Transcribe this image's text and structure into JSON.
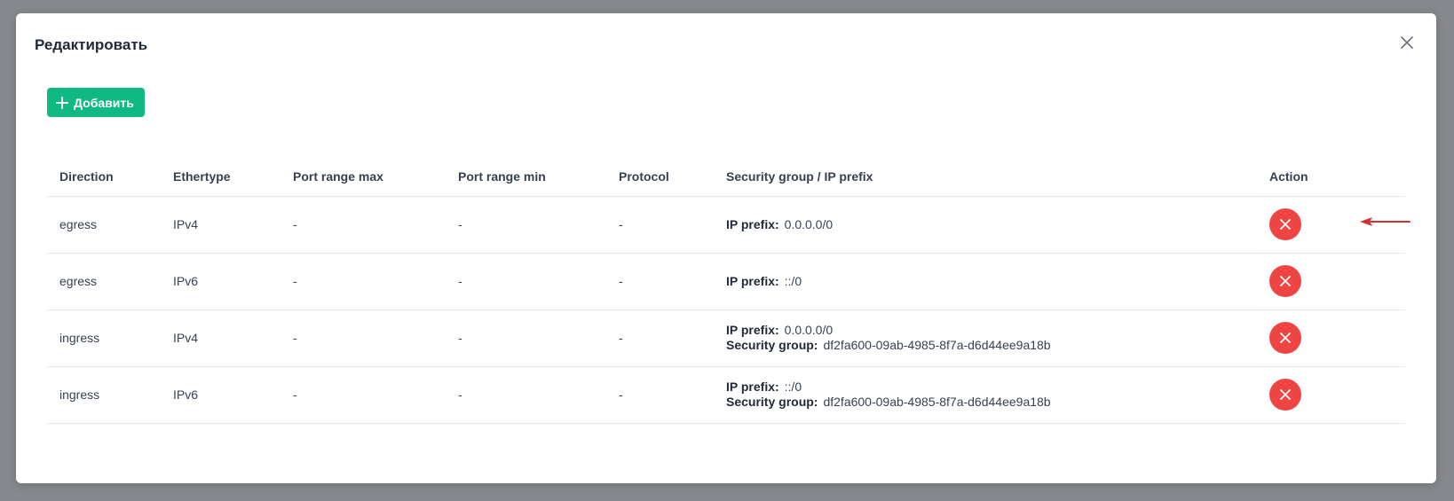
{
  "modal": {
    "title": "Редактировать",
    "add_label": "Добавить"
  },
  "table": {
    "columns": [
      "Direction",
      "Ethertype",
      "Port range max",
      "Port range min",
      "Protocol",
      "Security group / IP prefix",
      "Action"
    ],
    "rows": [
      {
        "direction": "egress",
        "ethertype": "IPv4",
        "port_max": "-",
        "port_min": "-",
        "protocol": "-",
        "ip_prefix_label": "IP prefix:",
        "ip_prefix": "0.0.0.0/0",
        "sg_label": "",
        "sg": ""
      },
      {
        "direction": "egress",
        "ethertype": "IPv6",
        "port_max": "-",
        "port_min": "-",
        "protocol": "-",
        "ip_prefix_label": "IP prefix:",
        "ip_prefix": "::/0",
        "sg_label": "",
        "sg": ""
      },
      {
        "direction": "ingress",
        "ethertype": "IPv4",
        "port_max": "-",
        "port_min": "-",
        "protocol": "-",
        "ip_prefix_label": "IP prefix:",
        "ip_prefix": "0.0.0.0/0",
        "sg_label": "Security group:",
        "sg": "df2fa600-09ab-4985-8f7a-d6d44ee9a18b"
      },
      {
        "direction": "ingress",
        "ethertype": "IPv6",
        "port_max": "-",
        "port_min": "-",
        "protocol": "-",
        "ip_prefix_label": "IP prefix:",
        "ip_prefix": "::/0",
        "sg_label": "Security group:",
        "sg": "df2fa600-09ab-4985-8f7a-d6d44ee9a18b"
      }
    ]
  },
  "colors": {
    "accent_green": "#10b981",
    "delete_red": "#ef4444",
    "annotation_arrow": "#d32f2f"
  },
  "icons": {
    "close": "close-icon",
    "add": "plus-icon",
    "delete": "x-icon",
    "annotation": "arrow-left-icon"
  }
}
